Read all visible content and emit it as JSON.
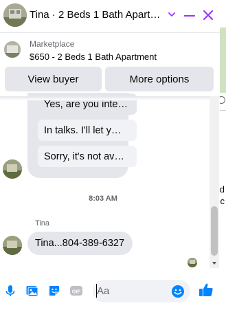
{
  "header": {
    "title": "Tina · 2 Beds 1 Bath Apart…",
    "chevron_icon": "chevron-down-icon",
    "minimize_icon": "minimize-icon",
    "close_icon": "close-icon",
    "accent": "#a033ff"
  },
  "marketplace": {
    "label": "Marketplace",
    "item": "$650 - 2 Beds 1 Bath Apartment",
    "view_buyer": "View buyer",
    "more_options": "More options"
  },
  "quick_replies": [
    "Yes, are you inte…",
    "In talks. I'll let y…",
    "Sorry, it's not av…"
  ],
  "timestamp": "8:03 AM",
  "last_message": {
    "sender": "Tina",
    "text": "Tina...804-389-6327"
  },
  "composer": {
    "placeholder": "Aa",
    "icons": [
      "microphone-icon",
      "photo-icon",
      "sticker-icon",
      "gif-icon",
      "emoji-icon",
      "like-icon"
    ],
    "gif_label": "GIF",
    "accent": "#0084ff"
  },
  "background_letters": [
    "d",
    "c"
  ]
}
